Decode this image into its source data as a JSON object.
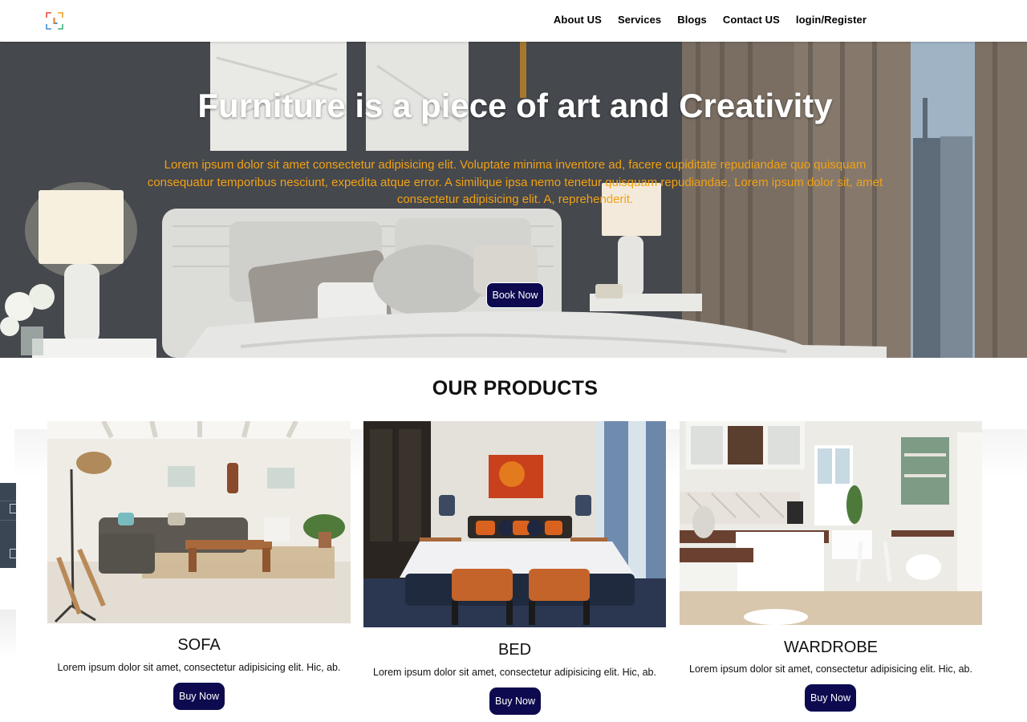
{
  "navbar": {
    "logo_icon": "brand-logo-icon",
    "links": [
      {
        "label": "About US"
      },
      {
        "label": "Services"
      },
      {
        "label": "Blogs"
      },
      {
        "label": "Contact US"
      },
      {
        "label": "login/Register"
      }
    ]
  },
  "hero": {
    "title": "Furniture is a piece of art and Creativity",
    "text": "Lorem ipsum dolor sit amet consectetur adipisicing elit. Voluptate minima inventore ad, facere cupiditate repudiandae quo quisquam consequatur temporibus nesciunt, expedita atque error. A similique ipsa nemo tenetur quisquam repudiandae. Lorem ipsum dolor sit, amet consectetur adipisicing elit. A, reprehenderit.",
    "button_label": "Book Now",
    "background_image": "bedroom-hero-photo"
  },
  "products": {
    "section_title": "OUR PRODUCTS",
    "items": [
      {
        "name": "SOFA",
        "description": "Lorem ipsum dolor sit amet, consectetur adipisicing elit. Hic, ab.",
        "button_label": "Buy Now",
        "image": "living-room-sofa-photo"
      },
      {
        "name": "BED",
        "description": "Lorem ipsum dolor sit amet, consectetur adipisicing elit. Hic, ab.",
        "button_label": "Buy Now",
        "image": "bedroom-bed-photo"
      },
      {
        "name": "WARDROBE",
        "description": "Lorem ipsum dolor sit amet, consectetur adipisicing elit. Hic, ab.",
        "button_label": "Buy Now",
        "image": "kitchen-wardrobe-photo"
      }
    ]
  },
  "colors": {
    "button_bg": "#0d0a4f",
    "hero_text": "#f2a114",
    "nav_bg": "#ffffff"
  }
}
